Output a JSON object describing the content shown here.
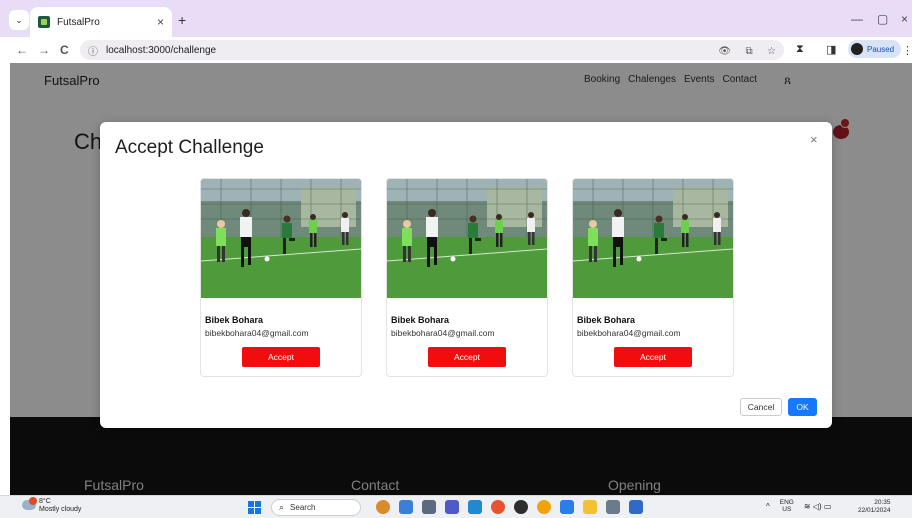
{
  "browser": {
    "tab_title": "FutsalPro",
    "tab_close": "×",
    "new_tab": "+",
    "tab_dropdown": "⌄",
    "url": "localhost:3000/challenge",
    "site_info": "ⓘ",
    "paused_label": "Paused",
    "kebab": "⋮",
    "icons": {
      "back": "←",
      "forward": "→",
      "reload": "C",
      "eye": "👁",
      "cast": "⧉",
      "star": "☆",
      "ext": "⧗",
      "split": "◨",
      "minimize": "—",
      "restore": "▢",
      "close": "×"
    }
  },
  "site": {
    "brand": "FutsalPro",
    "menu": [
      "Booking",
      "Chalenges",
      "Events",
      "Contact"
    ],
    "user_icon": "ጸ",
    "page_title_partial": "Ch",
    "footer": [
      "FutsalPro",
      "Contact",
      "Opening"
    ]
  },
  "modal": {
    "title": "Accept Challenge",
    "close": "×",
    "cards": [
      {
        "name": "Bibek Bohara",
        "email": "bibekbohara04@gmail.com",
        "button": "Accept"
      },
      {
        "name": "Bibek Bohara",
        "email": "bibekbohara04@gmail.com",
        "button": "Accept"
      },
      {
        "name": "Bibek Bohara",
        "email": "bibekbohara04@gmail.com",
        "button": "Accept"
      }
    ],
    "cancel": "Cancel",
    "ok": "OK"
  },
  "taskbar": {
    "temp": "8°C",
    "weather": "Mostly cloudy",
    "search": "Search",
    "lang_line1": "ENG",
    "lang_line2": "US",
    "time": "20:35",
    "date": "22/01/2024",
    "tray_up": "^",
    "tray_icons": "≋ ◁) ▭"
  },
  "colors": {
    "accept": "#f10d0d",
    "ok": "#1677ff",
    "footer": "#141416",
    "tabbar": "#e9dcf6"
  }
}
